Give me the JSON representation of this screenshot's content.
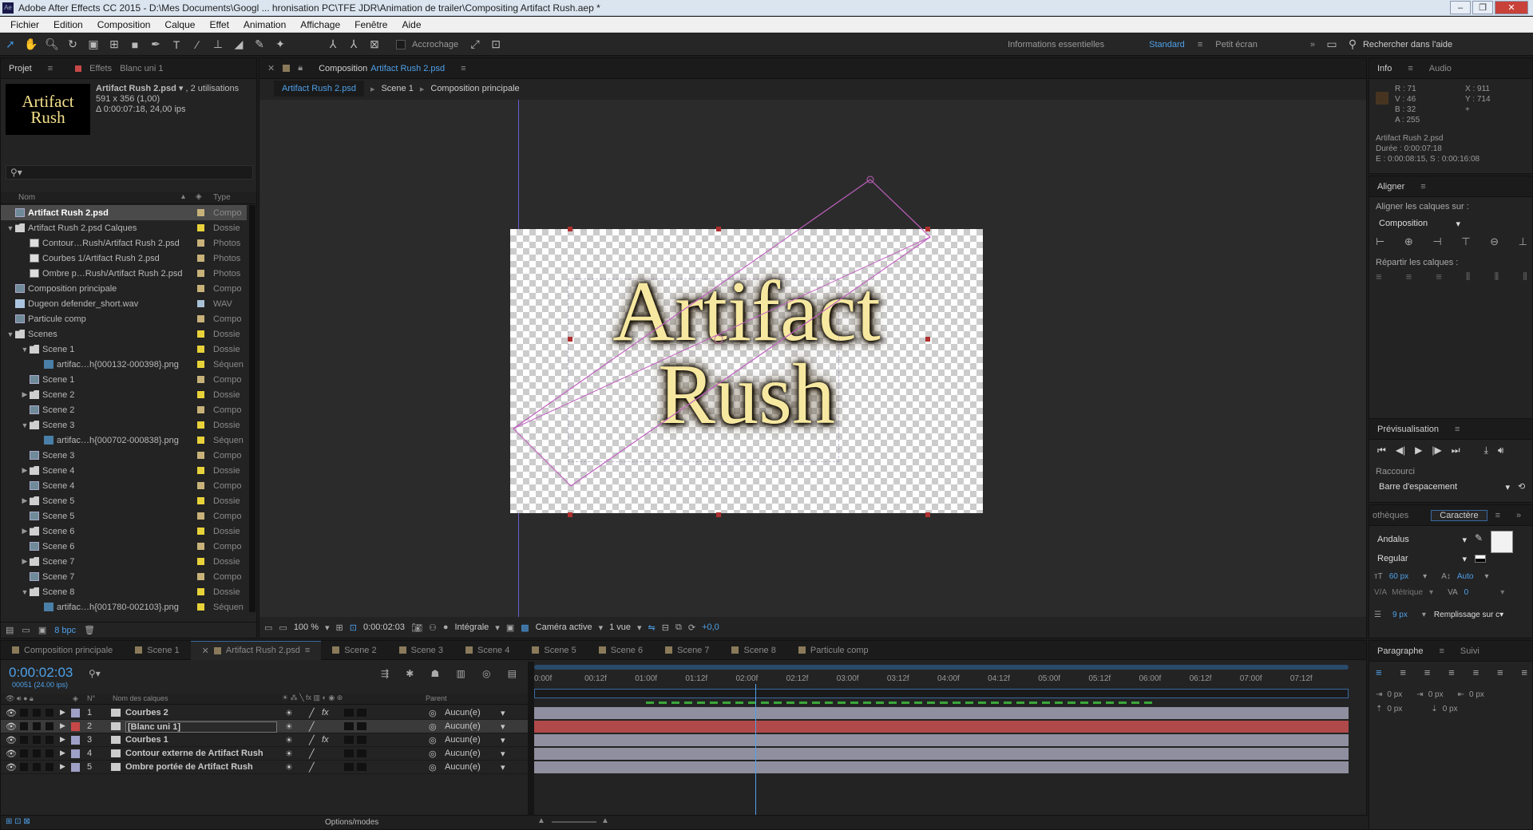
{
  "titlebar": {
    "app_icon": "Ae",
    "title": "Adobe After Effects CC 2015 - D:\\Mes Documents\\Googl ... hronisation PC\\TFE JDR\\Animation de trailer\\Compositing Artifact Rush.aep *"
  },
  "menu": [
    "Fichier",
    "Edition",
    "Composition",
    "Calque",
    "Effet",
    "Animation",
    "Affichage",
    "Fenêtre",
    "Aide"
  ],
  "toolbar": {
    "snap_label": "Accrochage",
    "workspaces": [
      "Informations essentielles",
      "Standard",
      "Petit écran"
    ],
    "active_workspace": "Standard",
    "search_help": "Rechercher dans l'aide"
  },
  "project": {
    "tab_label": "Projet",
    "effects_tab": "Effets",
    "effects_target": "Blanc uni 1",
    "thumb_line1": "Artifact",
    "thumb_line2": "Rush",
    "item_name": "Artifact Rush 2.psd",
    "item_usage": ", 2 utilisations",
    "item_dims": "591 x 356 (1,00)",
    "item_duration": "Δ 0:00:07:18, 24,00 ips",
    "col_name": "Nom",
    "col_type": "Type",
    "bpc": "8 bpc",
    "items": [
      {
        "indent": 0,
        "tri": "",
        "icon": "comp",
        "name": "Artifact Rush 2.psd",
        "color": "#c8b27a",
        "type": "Compo",
        "selected": true
      },
      {
        "indent": 0,
        "tri": "▼",
        "icon": "folder",
        "name": "Artifact Rush 2.psd Calques",
        "color": "#e8d23a",
        "type": "Dossie"
      },
      {
        "indent": 1,
        "tri": "",
        "icon": "photo",
        "name": "Contour…Rush/Artifact Rush 2.psd",
        "color": "#c8b27a",
        "type": "Photos"
      },
      {
        "indent": 1,
        "tri": "",
        "icon": "photo",
        "name": "Courbes 1/Artifact Rush 2.psd",
        "color": "#c8b27a",
        "type": "Photos"
      },
      {
        "indent": 1,
        "tri": "",
        "icon": "photo",
        "name": "Ombre p…Rush/Artifact Rush 2.psd",
        "color": "#c8b27a",
        "type": "Photos"
      },
      {
        "indent": 0,
        "tri": "",
        "icon": "comp",
        "name": "Composition principale",
        "color": "#c8b27a",
        "type": "Compo"
      },
      {
        "indent": 0,
        "tri": "",
        "icon": "wav",
        "name": "Dugeon defender_short.wav",
        "color": "#a9c1d6",
        "type": "WAV"
      },
      {
        "indent": 0,
        "tri": "",
        "icon": "comp",
        "name": "Particule comp",
        "color": "#c8b27a",
        "type": "Compo"
      },
      {
        "indent": 0,
        "tri": "▼",
        "icon": "folder",
        "name": "Scenes",
        "color": "#e8d23a",
        "type": "Dossie"
      },
      {
        "indent": 1,
        "tri": "▼",
        "icon": "folder",
        "name": "Scene 1",
        "color": "#e8d23a",
        "type": "Dossie"
      },
      {
        "indent": 2,
        "tri": "",
        "icon": "seq",
        "name": "artifac…h{000132-000398}.png",
        "color": "#e8d23a",
        "type": "Séquen"
      },
      {
        "indent": 1,
        "tri": "",
        "icon": "comp",
        "name": "Scene 1",
        "color": "#c8b27a",
        "type": "Compo"
      },
      {
        "indent": 1,
        "tri": "▶",
        "icon": "folder",
        "name": "Scene 2",
        "color": "#e8d23a",
        "type": "Dossie"
      },
      {
        "indent": 1,
        "tri": "",
        "icon": "comp",
        "name": "Scene 2",
        "color": "#c8b27a",
        "type": "Compo"
      },
      {
        "indent": 1,
        "tri": "▼",
        "icon": "folder",
        "name": "Scene 3",
        "color": "#e8d23a",
        "type": "Dossie"
      },
      {
        "indent": 2,
        "tri": "",
        "icon": "seq",
        "name": "artifac…h{000702-000838}.png",
        "color": "#e8d23a",
        "type": "Séquen"
      },
      {
        "indent": 1,
        "tri": "",
        "icon": "comp",
        "name": "Scene 3",
        "color": "#c8b27a",
        "type": "Compo"
      },
      {
        "indent": 1,
        "tri": "▶",
        "icon": "folder",
        "name": "Scene 4",
        "color": "#e8d23a",
        "type": "Dossie"
      },
      {
        "indent": 1,
        "tri": "",
        "icon": "comp",
        "name": "Scene 4",
        "color": "#c8b27a",
        "type": "Compo"
      },
      {
        "indent": 1,
        "tri": "▶",
        "icon": "folder",
        "name": "Scene 5",
        "color": "#e8d23a",
        "type": "Dossie"
      },
      {
        "indent": 1,
        "tri": "",
        "icon": "comp",
        "name": "Scene 5",
        "color": "#c8b27a",
        "type": "Compo"
      },
      {
        "indent": 1,
        "tri": "▶",
        "icon": "folder",
        "name": "Scene 6",
        "color": "#e8d23a",
        "type": "Dossie"
      },
      {
        "indent": 1,
        "tri": "",
        "icon": "comp",
        "name": "Scene 6",
        "color": "#c8b27a",
        "type": "Compo"
      },
      {
        "indent": 1,
        "tri": "▶",
        "icon": "folder",
        "name": "Scene 7",
        "color": "#e8d23a",
        "type": "Dossie"
      },
      {
        "indent": 1,
        "tri": "",
        "icon": "comp",
        "name": "Scene 7",
        "color": "#c8b27a",
        "type": "Compo"
      },
      {
        "indent": 1,
        "tri": "▼",
        "icon": "folder",
        "name": "Scene 8",
        "color": "#e8d23a",
        "type": "Dossie"
      },
      {
        "indent": 2,
        "tri": "",
        "icon": "seq",
        "name": "artifac…h{001780-002103}.png",
        "color": "#e8d23a",
        "type": "Séquen"
      },
      {
        "indent": 1,
        "tri": "",
        "icon": "comp",
        "name": "Scene 8",
        "color": "#c8b27a",
        "type": "Compo"
      }
    ]
  },
  "composition": {
    "tab_prefix": "Composition",
    "tab_name": "Artifact Rush 2.psd",
    "breadcrumbs": [
      "Artifact Rush 2.psd",
      "Scene 1",
      "Composition principale"
    ],
    "text_line1": "Artifact",
    "text_line2": "Rush",
    "zoom": "100 %",
    "timecode": "0:00:02:03",
    "resolution": "Intégrale",
    "camera": "Caméra active",
    "views": "1 vue",
    "exposure": "+0,0"
  },
  "info": {
    "tab": "Info",
    "audio_tab": "Audio",
    "swatch": "#473420",
    "r": "R : 71",
    "v": "V : 46",
    "b": "B : 32",
    "a": "A : 255",
    "x": "X : 911",
    "y": "Y : 714",
    "layer": "Artifact Rush 2.psd",
    "duration": "Durée : 0:00:07:18",
    "in_out": "E : 0:00:08:15, S : 0:00:16:08"
  },
  "align": {
    "title": "Aligner",
    "align_to_label": "Aligner les calques sur :",
    "align_to_value": "Composition",
    "distribute_label": "Répartir les calques :"
  },
  "preview": {
    "title": "Prévisualisation",
    "shortcut_label": "Raccourci",
    "shortcut_value": "Barre d'espacement"
  },
  "character": {
    "tab_other": "othèques",
    "tab": "Caractère",
    "font": "Andalus",
    "style": "Regular",
    "size": "60 px",
    "leading": "Auto",
    "kerning": "Métrique",
    "tracking": "0",
    "stroke_width": "9 px",
    "stroke_mode": "Remplissage sur c"
  },
  "paragraph": {
    "tab": "Paragraphe",
    "follow_tab": "Suivi",
    "indent_left": "0 px",
    "indent_first": "0 px",
    "indent_right": "0 px",
    "space_before": "0 px",
    "space_after": "0 px"
  },
  "timeline": {
    "tabs": [
      "Composition principale",
      "Scene 1",
      "Artifact Rush 2.psd",
      "Scene 2",
      "Scene 3",
      "Scene 4",
      "Scene 5",
      "Scene 6",
      "Scene 7",
      "Scene 8",
      "Particule comp"
    ],
    "tab_colors": [
      "#8a7a5a",
      "#8a7a5a",
      "#8a7a5a",
      "#8a7a5a",
      "#8a7a5a",
      "#8a7a5a",
      "#8a7a5a",
      "#8a7a5a",
      "#8a7a5a",
      "#8a7a5a",
      "#8a7a5a"
    ],
    "active_tab": 2,
    "timecode": "0:00:02:03",
    "frame_info": "00051 (24.00 ips)",
    "col_num": "N°",
    "col_name": "Nom des calques",
    "col_parent": "Parent",
    "options_label": "Options/modes",
    "ruler": [
      "0:00f",
      "00:12f",
      "01:00f",
      "01:12f",
      "02:00f",
      "02:12f",
      "03:00f",
      "03:12f",
      "04:00f",
      "04:12f",
      "05:00f",
      "05:12f",
      "06:00f",
      "06:12f",
      "07:00f",
      "07:12f"
    ],
    "playhead_frames": 51,
    "total_frames": 186,
    "layers": [
      {
        "num": "1",
        "name": "Courbes 2",
        "bracket": false,
        "label": "#9fa0c8",
        "fx": true,
        "parent": "Aucun(e)",
        "bar": "#8f8f9f"
      },
      {
        "num": "2",
        "name": "[Blanc uni 1]",
        "bracket": true,
        "label": "#c84848",
        "fx": false,
        "parent": "Aucun(e)",
        "bar": "#b04a4a",
        "selected": true
      },
      {
        "num": "3",
        "name": "Courbes 1",
        "bracket": false,
        "label": "#9fa0c8",
        "fx": true,
        "parent": "Aucun(e)",
        "bar": "#8f8f9f"
      },
      {
        "num": "4",
        "name": "Contour externe de Artifact Rush",
        "bracket": false,
        "label": "#9fa0c8",
        "fx": false,
        "parent": "Aucun(e)",
        "bar": "#8f8f9f"
      },
      {
        "num": "5",
        "name": "Ombre portée de Artifact Rush",
        "bracket": false,
        "label": "#9fa0c8",
        "fx": false,
        "parent": "Aucun(e)",
        "bar": "#8f8f9f"
      }
    ]
  }
}
